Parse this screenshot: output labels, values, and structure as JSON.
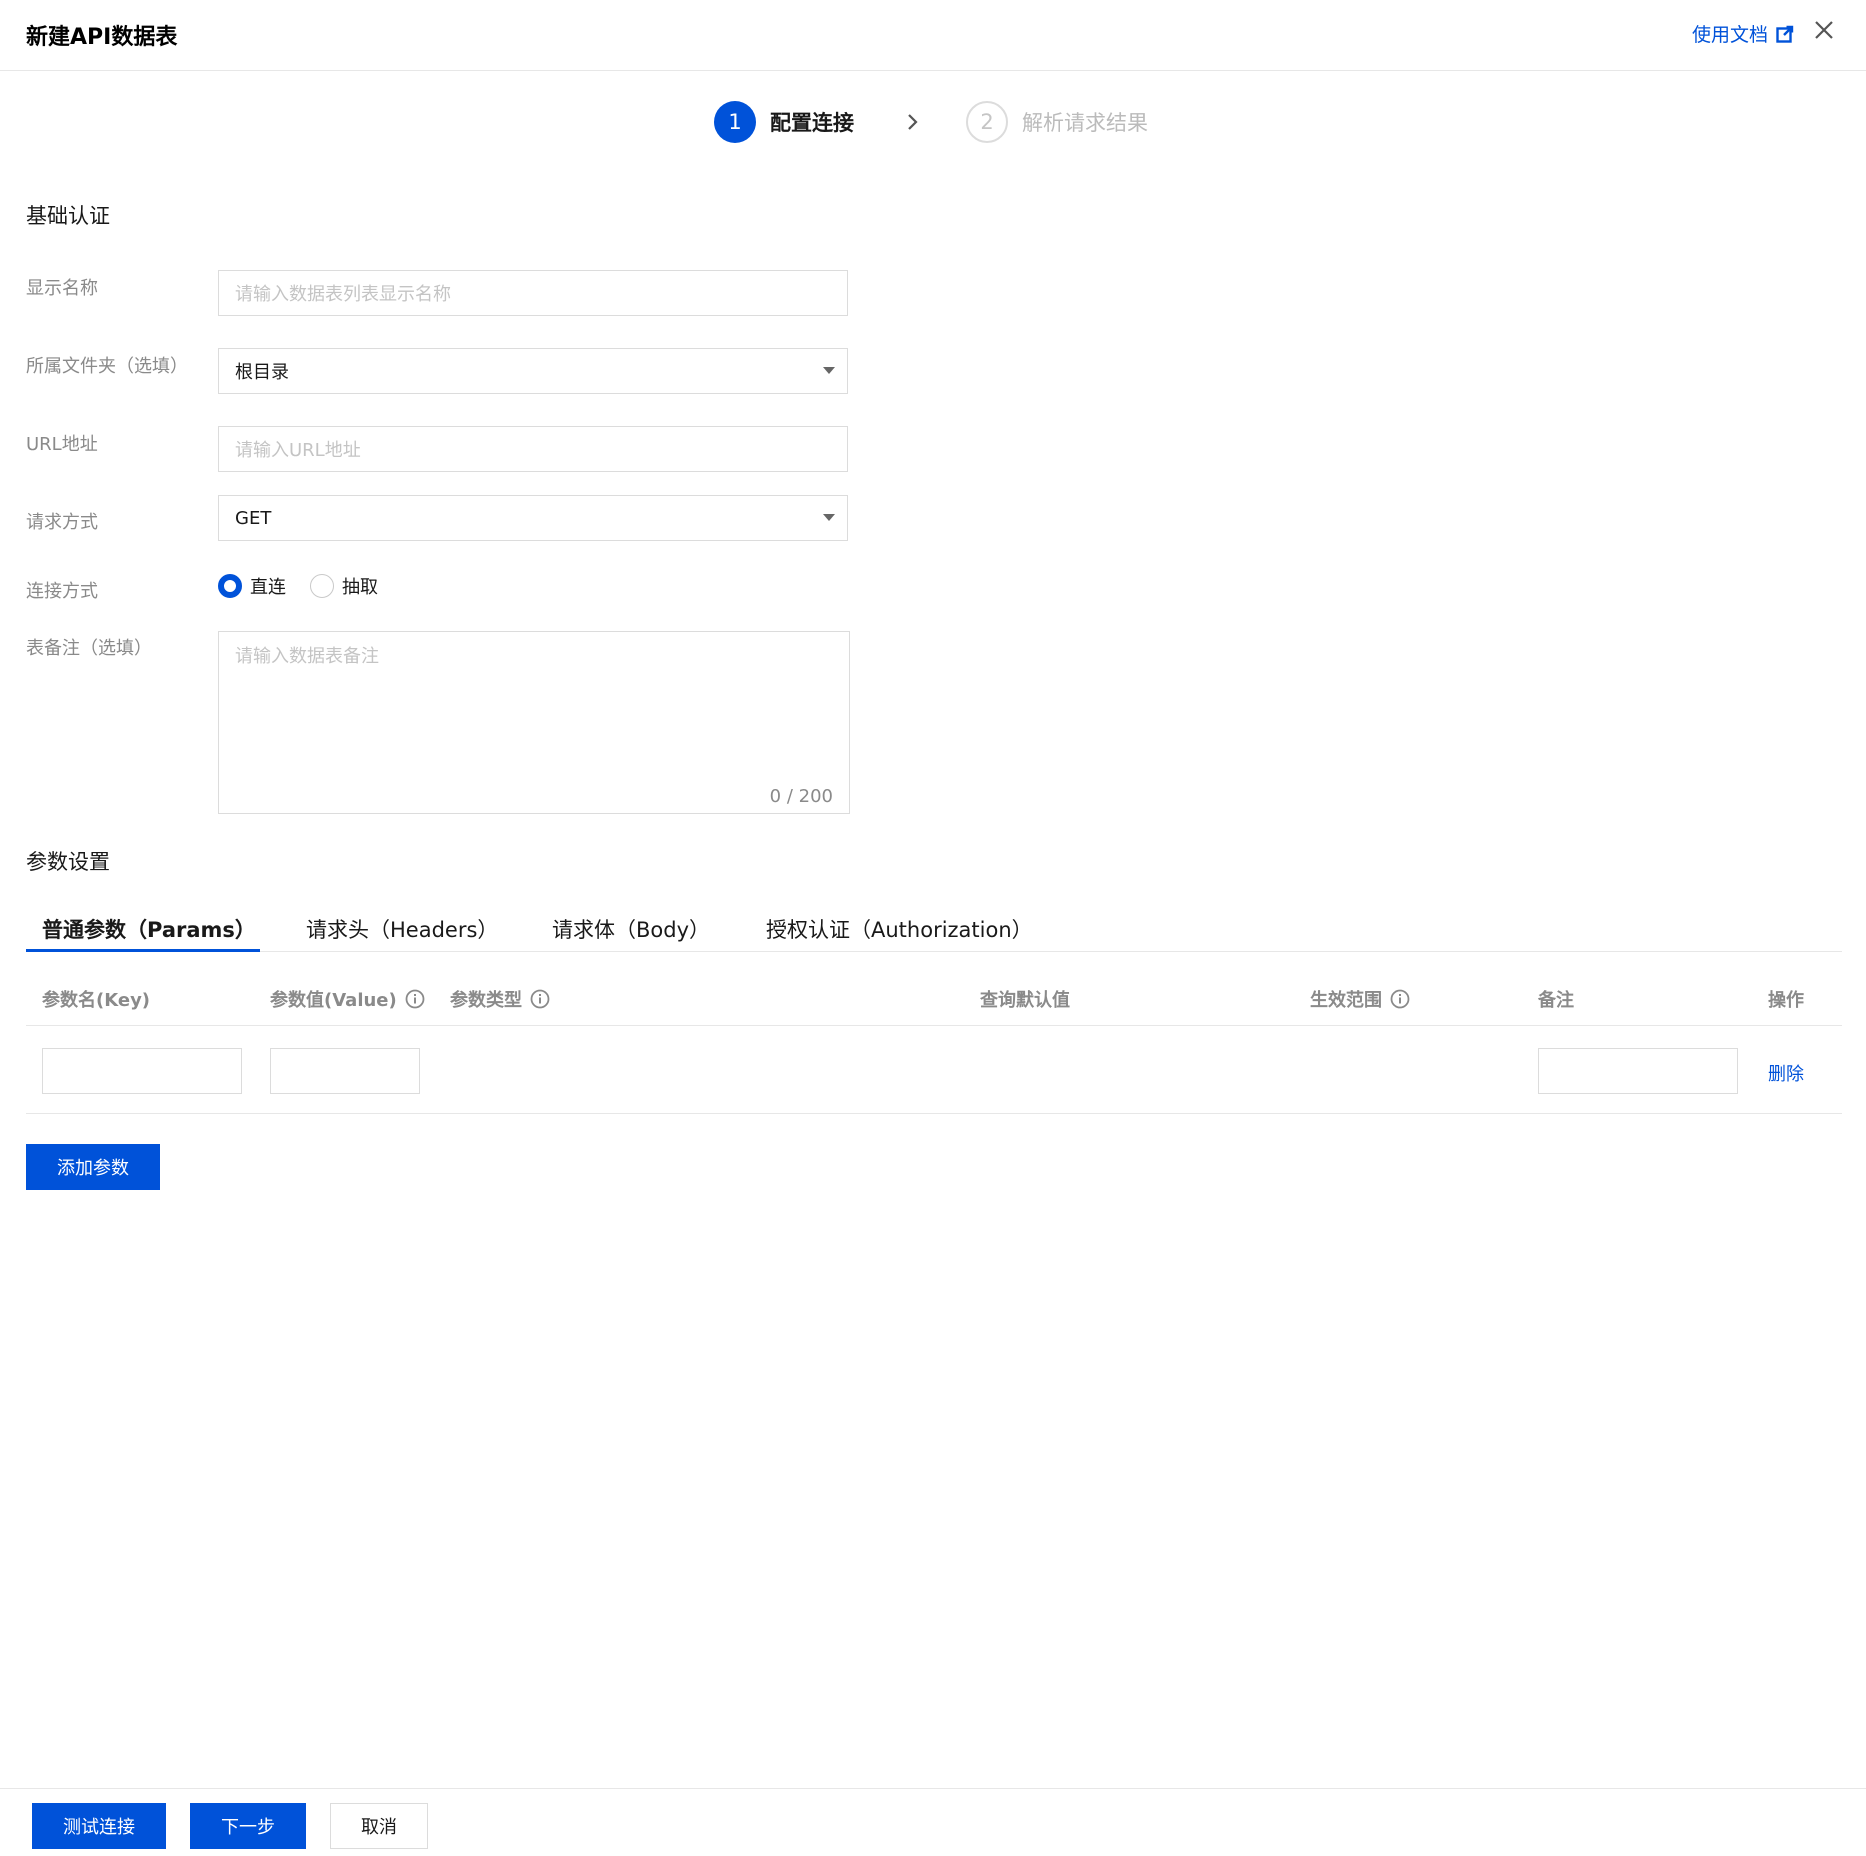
{
  "header": {
    "title": "新建API数据表",
    "doc_link": "使用文档",
    "doc_icon": "external-link-icon",
    "close_icon": "close-icon"
  },
  "steps": [
    {
      "number": "1",
      "label": "配置连接",
      "state": "active"
    },
    {
      "number": "2",
      "label": "解析请求结果",
      "state": "inactive"
    }
  ],
  "basic": {
    "section_title": "基础认证",
    "display_name": {
      "label": "显示名称",
      "placeholder": "请输入数据表列表显示名称"
    },
    "folder": {
      "label": "所属文件夹（选填）",
      "value": "根目录"
    },
    "url": {
      "label": "URL地址",
      "placeholder": "请输入URL地址"
    },
    "method": {
      "label": "请求方式",
      "value": "GET"
    },
    "connection": {
      "label": "连接方式",
      "options": [
        {
          "label": "直连",
          "checked": true
        },
        {
          "label": "抽取",
          "checked": false
        }
      ]
    },
    "remark": {
      "label": "表备注（选填）",
      "placeholder": "请输入数据表备注",
      "counter": "0 / 200"
    }
  },
  "params": {
    "section_title": "参数设置",
    "tabs": [
      "普通参数（Params）",
      "请求头（Headers）",
      "请求体（Body）",
      "授权认证（Authorization）"
    ],
    "active_tab": 0,
    "columns": [
      "参数名(Key)",
      "参数值(Value)",
      "参数类型",
      "查询默认值",
      "生效范围",
      "备注",
      "操作"
    ],
    "row_action": "删除",
    "add_button": "添加参数"
  },
  "footer": {
    "test_button": "测试连接",
    "next_button": "下一步",
    "cancel_button": "取消"
  },
  "colors": {
    "primary": "#0052d9",
    "border": "#dcdcdc"
  }
}
